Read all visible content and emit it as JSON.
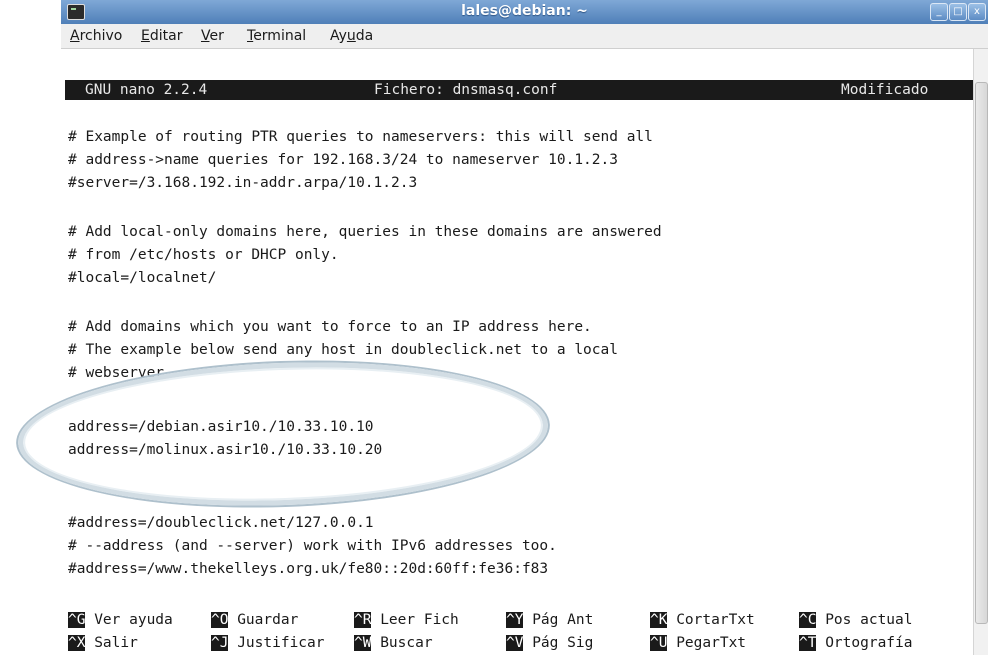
{
  "window": {
    "title": "lales@debian: ~"
  },
  "menu": [
    {
      "pre": "",
      "u": "A",
      "post": "rchivo"
    },
    {
      "pre": "",
      "u": "E",
      "post": "ditar"
    },
    {
      "pre": "",
      "u": "V",
      "post": "er"
    },
    {
      "pre": "",
      "u": "T",
      "post": "erminal"
    },
    {
      "pre": "Ay",
      "u": "u",
      "post": "da"
    }
  ],
  "nano": {
    "version": "GNU nano 2.2.4",
    "file": "Fichero: dnsmasq.conf",
    "status": "Modificado"
  },
  "lines": [
    "# Example of routing PTR queries to nameservers: this will send all",
    "# address->name queries for 192.168.3/24 to nameserver 10.1.2.3",
    "#server=/3.168.192.in-addr.arpa/10.1.2.3",
    "",
    "# Add local-only domains here, queries in these domains are answered",
    "# from /etc/hosts or DHCP only.",
    "#local=/localnet/",
    "",
    "# Add domains which you want to force to an IP address here.",
    "# The example below send any host in doubleclick.net to a local",
    "# webserver.",
    "",
    "address=/debian.asir10./10.33.10.10",
    "address=/molinux.asir10./10.33.10.20",
    "",
    "",
    "#address=/doubleclick.net/127.0.0.1",
    "# --address (and --server) work with IPv6 addresses too.",
    "#address=/www.thekelleys.org.uk/fe80::20d:60ff:fe36:f83"
  ],
  "shortcuts_row1": [
    {
      "key": "^G",
      "label": " Ver ayuda"
    },
    {
      "key": "^O",
      "label": " Guardar"
    },
    {
      "key": "^R",
      "label": " Leer Fich"
    },
    {
      "key": "^Y",
      "label": " Pág Ant"
    },
    {
      "key": "^K",
      "label": " CortarTxt"
    },
    {
      "key": "^C",
      "label": " Pos actual"
    }
  ],
  "shortcuts_row2": [
    {
      "key": "^X",
      "label": " Salir"
    },
    {
      "key": "^J",
      "label": " Justificar"
    },
    {
      "key": "^W",
      "label": " Buscar"
    },
    {
      "key": "^V",
      "label": " Pág Sig"
    },
    {
      "key": "^U",
      "label": " PegarTxt"
    },
    {
      "key": "^T",
      "label": " Ortografía"
    }
  ]
}
